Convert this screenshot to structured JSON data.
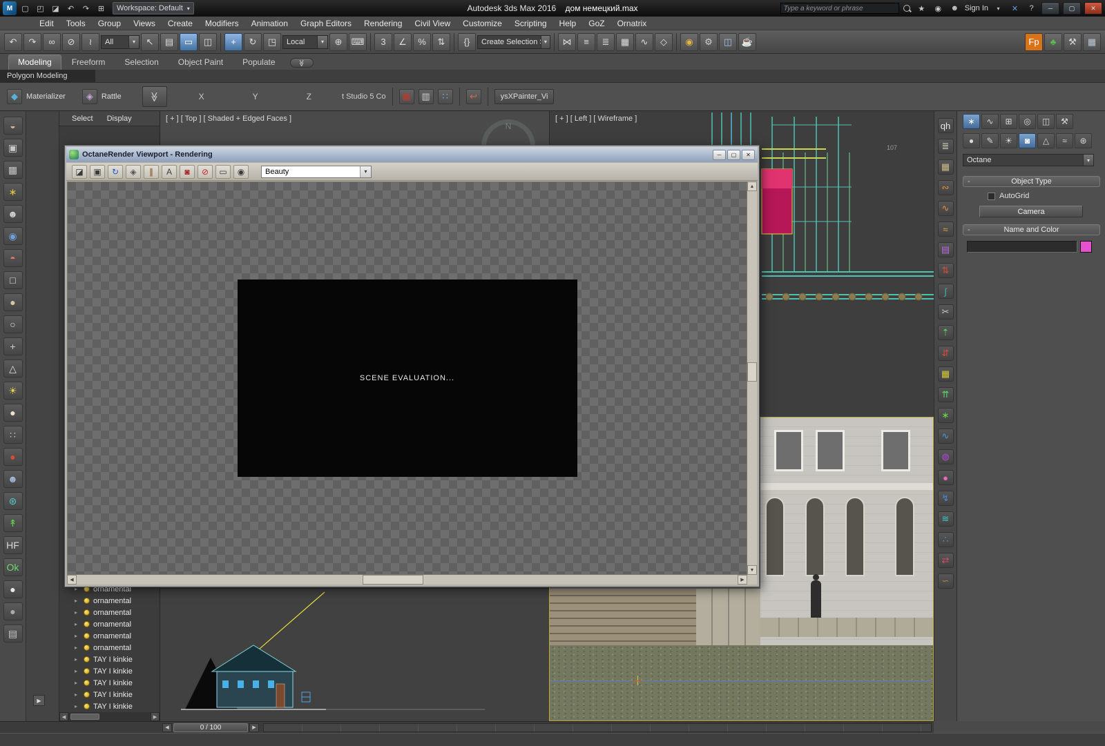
{
  "glyphs": {
    "expand": "▸",
    "dd": "▾",
    "chev2": "≫",
    "min": "─",
    "max": "▢",
    "close": "✕",
    "help": "?",
    "left": "◀",
    "right": "▶",
    "up": "▲",
    "down": "▼"
  },
  "titlebar": {
    "logo_text": "M",
    "quick_icons": [
      {
        "n": "new-scene-icon",
        "g": "▢"
      },
      {
        "n": "open-file-icon",
        "g": "◰"
      },
      {
        "n": "save-file-icon",
        "g": "◪"
      },
      {
        "n": "undo-small-icon",
        "g": "↶"
      },
      {
        "n": "redo-small-icon",
        "g": "↷"
      },
      {
        "n": "project-folder-icon",
        "g": "⊞"
      }
    ],
    "workspace": "Workspace: Default",
    "app_title": "Autodesk 3ds Max 2016",
    "doc_title": "дом немецкий.max",
    "search_placeholder": "Type a keyword or phrase",
    "infocenter_icons": [
      {
        "n": "favorites-star-icon",
        "g": "★"
      },
      {
        "n": "communication-center-icon",
        "g": "◉"
      },
      {
        "n": "user-icon",
        "g": "☻"
      }
    ],
    "sign_in": "Sign In",
    "app_x_icon": "✕"
  },
  "menu": {
    "items": [
      "Edit",
      "Tools",
      "Group",
      "Views",
      "Create",
      "Modifiers",
      "Animation",
      "Graph Editors",
      "Rendering",
      "Civil View",
      "Customize",
      "Scripting",
      "Help",
      "GoZ",
      "Ornatrix"
    ]
  },
  "toolbar_main": {
    "filter_value": "All",
    "coord_value": "Local",
    "selection_set_value": "Create Selection Se",
    "icons_a": [
      {
        "n": "undo-icon",
        "g": "↶"
      },
      {
        "n": "redo-icon",
        "g": "↷"
      },
      {
        "n": "select-and-link-icon",
        "g": "∞"
      },
      {
        "n": "unlink-selection-icon",
        "g": "⊘"
      },
      {
        "n": "bind-to-space-warp-icon",
        "g": "≀"
      }
    ],
    "icons_b": [
      {
        "n": "select-object-icon",
        "g": "↖"
      },
      {
        "n": "select-by-name-icon",
        "g": "▤"
      },
      {
        "n": "selection-region-icon",
        "g": "▭",
        "hl": true
      },
      {
        "n": "window-crossing-icon",
        "g": "◫"
      }
    ],
    "icons_c": [
      {
        "n": "select-and-move-icon",
        "g": "+",
        "hl": true
      },
      {
        "n": "select-and-rotate-icon",
        "g": "↻"
      },
      {
        "n": "select-and-scale-icon",
        "g": "◳"
      }
    ],
    "icons_d": [
      {
        "n": "select-and-manipulate-icon",
        "g": "⊕"
      },
      {
        "n": "keyboard-override-icon",
        "g": "⌨"
      }
    ],
    "icons_e": [
      {
        "n": "snaps-toggle-icon",
        "g": "3"
      },
      {
        "n": "angle-snap-icon",
        "g": "∠"
      },
      {
        "n": "percent-snap-icon",
        "g": "%"
      },
      {
        "n": "spinner-snap-icon",
        "g": "⇅"
      }
    ],
    "icons_f": [
      {
        "n": "named-selection-sets-icon",
        "g": "{}"
      }
    ],
    "icons_g": [
      {
        "n": "mirror-icon",
        "g": "⋈"
      },
      {
        "n": "align-icon",
        "g": "≡"
      },
      {
        "n": "layer-manager-icon",
        "g": "≣"
      },
      {
        "n": "ribbon-toggle-icon",
        "g": "▦"
      },
      {
        "n": "curve-editor-icon",
        "g": "∿"
      },
      {
        "n": "schematic-view-icon",
        "g": "◇"
      }
    ],
    "icons_h": [
      {
        "n": "material-editor-icon",
        "g": "◉",
        "c": "#e3b341"
      },
      {
        "n": "render-setup-icon",
        "g": "⚙",
        "c": "#cfcfcf"
      },
      {
        "n": "rendered-frame-window-icon",
        "g": "◫",
        "c": "#9fc3e8"
      },
      {
        "n": "render-production-icon",
        "g": "☕",
        "c": "#e0a060"
      }
    ],
    "icons_i": [
      {
        "n": "fp-plugin-button",
        "g": "Fp",
        "bg": "#d8731a",
        "c": "#fff"
      },
      {
        "n": "forest-plugin-icon",
        "g": "♣",
        "c": "#55c14f"
      },
      {
        "n": "tools-plugin-icon",
        "g": "⚒",
        "c": "#d8d8d8"
      },
      {
        "n": "grid-plugin-icon",
        "g": "▦",
        "c": "#bac9d8"
      }
    ]
  },
  "ribbon": {
    "tabs": [
      {
        "label": "Modeling",
        "active": true
      },
      {
        "label": "Freeform"
      },
      {
        "label": "Selection"
      },
      {
        "label": "Object Paint"
      },
      {
        "label": "Populate"
      }
    ],
    "subtab": "Polygon Modeling"
  },
  "toolbar2": {
    "materializer": "Materializer",
    "rattle": "Rattle",
    "x": "X",
    "y": "Y",
    "z": "Z",
    "studio": "t Studio 5 Co",
    "painter": "ysXPainter_Vi",
    "icons": [
      {
        "n": "fence-grid-icon",
        "g": "▦",
        "c": "#c0392b"
      },
      {
        "n": "ruler-icon",
        "g": "▥",
        "c": "#cfcfcf"
      },
      {
        "n": "dots-grid-icon",
        "g": "∷",
        "c": "#7fb3e8"
      }
    ],
    "curve_arrow_icon": "↩"
  },
  "left_toolbar": {
    "icons": [
      {
        "n": "teapot-icon",
        "g": "◒",
        "c": "#c9b79a"
      },
      {
        "n": "image-plane-icon",
        "g": "▣",
        "c": "#c8c8c8"
      },
      {
        "n": "grid-array-icon",
        "g": "▦",
        "c": "#c8c8c8"
      },
      {
        "n": "spark-icon",
        "g": "∗",
        "c": "#e6c63c"
      },
      {
        "n": "figure-icon",
        "g": "☻",
        "c": "#cfcfcf"
      },
      {
        "n": "orb-blue-icon",
        "g": "◉",
        "c": "#6f9fd8"
      },
      {
        "n": "ball-duo-icon",
        "g": "◓",
        "c": "#d87a66"
      },
      {
        "n": "box-icon",
        "g": "□",
        "c": "#e0e0e0"
      },
      {
        "n": "sphere-tan-icon",
        "g": "●",
        "c": "#d8c8a4"
      },
      {
        "n": "circle-icon",
        "g": "○",
        "c": "#e0e0e0"
      },
      {
        "n": "cross-tool-icon",
        "g": "+",
        "c": "#d0d0d0"
      },
      {
        "n": "cone-icon",
        "g": "△",
        "c": "#e0e0e0"
      },
      {
        "n": "sun-icon",
        "g": "☀",
        "c": "#e8d34a"
      },
      {
        "n": "sphere-cream-icon",
        "g": "●",
        "c": "#ece4cc"
      },
      {
        "n": "dots-icon",
        "g": "∷",
        "c": "#c8c8c8"
      },
      {
        "n": "sphere-red-icon",
        "g": "●",
        "c": "#d84a38"
      },
      {
        "n": "figure-blue-icon",
        "g": "☻",
        "c": "#9fb8d8"
      },
      {
        "n": "gear-teal-icon",
        "g": "⊛",
        "c": "#59c9c9"
      },
      {
        "n": "plant-icon",
        "g": "↟",
        "c": "#63d44f"
      },
      {
        "n": "hf-icon",
        "g": "HF",
        "c": "#d8d8d8"
      },
      {
        "n": "ok-icon",
        "g": "Ok",
        "c": "#6fd86f"
      },
      {
        "n": "sphere-white-icon",
        "g": "●",
        "c": "#e8e8e8"
      },
      {
        "n": "sphere-gray-icon",
        "g": "●",
        "c": "#aaaaaa"
      },
      {
        "n": "panel-icon",
        "g": "▤",
        "c": "#c8c8c8"
      }
    ]
  },
  "explorer": {
    "menus": [
      "Select",
      "Display"
    ],
    "rows": [
      {
        "l": "ornamental"
      },
      {
        "l": "ornamental"
      },
      {
        "l": "ornamental"
      },
      {
        "l": "ornamental"
      },
      {
        "l": "ornamental"
      },
      {
        "l": "ornamental"
      },
      {
        "l": "TAY I kinkie"
      },
      {
        "l": "TAY I kinkie"
      },
      {
        "l": "TAY I kinkie"
      },
      {
        "l": "TAY I kinkie"
      },
      {
        "l": "TAY I kinkie"
      }
    ]
  },
  "viewports": {
    "top_label": "[ + ] [ Top ] [ Shaded + Edged Faces ]",
    "left_label": "[ + ] [ Left ] [ Wireframe ]",
    "compass": "N",
    "cad_note": "107"
  },
  "render_window": {
    "title": "OctaneRender Viewport - Rendering",
    "pass_value": "Beauty",
    "status_text": "SCENE EVALUATION...",
    "toolbar_icons": [
      {
        "n": "save-image-icon",
        "g": "◪",
        "c": "#3a3a3a"
      },
      {
        "n": "copy-image-icon",
        "g": "▣",
        "c": "#3a3a3a"
      },
      {
        "n": "refresh-render-icon",
        "g": "↻",
        "c": "#2255cc"
      },
      {
        "n": "lock-view-icon",
        "g": "◈",
        "c": "#555555"
      },
      {
        "n": "pause-render-icon",
        "g": "∥",
        "c": "#7a4a10"
      },
      {
        "n": "stamp-text-icon",
        "g": "A",
        "c": "#3a3a3a"
      },
      {
        "n": "render-region-icon",
        "g": "◙",
        "c": "#aa2222"
      },
      {
        "n": "stop-render-icon",
        "g": "⊘",
        "c": "#cc2222"
      },
      {
        "n": "display-mode-icon",
        "g": "▭",
        "c": "#3a3a3a"
      },
      {
        "n": "camera-lock-icon",
        "g": "◉",
        "c": "#3a3a3a"
      }
    ]
  },
  "ornatrix": {
    "icons": [
      {
        "n": "ornatrix-qh-icon",
        "g": "qh",
        "c": "#e8e8e8"
      },
      {
        "n": "ornatrix-guides-icon",
        "g": "≣",
        "c": "#dcd6c8"
      },
      {
        "n": "ornatrix-box-icon",
        "g": "▦",
        "c": "#cbb98a"
      },
      {
        "n": "ornatrix-curl-icon",
        "g": "∾",
        "c": "#e8923a"
      },
      {
        "n": "ornatrix-strand-icon",
        "g": "∿",
        "c": "#e8923a"
      },
      {
        "n": "ornatrix-waves-icon",
        "g": "≈",
        "c": "#e8a23a"
      },
      {
        "n": "ornatrix-stack-icon",
        "g": "▤",
        "c": "#b86ad8"
      },
      {
        "n": "ornatrix-updown-icon",
        "g": "⇅",
        "c": "#d84a3a"
      },
      {
        "n": "ornatrix-flow-icon",
        "g": "∫",
        "c": "#3ab8a8"
      },
      {
        "n": "ornatrix-scissors-icon",
        "g": "✂",
        "c": "#c8c8c8"
      },
      {
        "n": "ornatrix-sprout-icon",
        "g": "⇡",
        "c": "#5ad85a"
      },
      {
        "n": "ornatrix-redgreen-icon",
        "g": "⇵",
        "c": "#d84a3a"
      },
      {
        "n": "ornatrix-grid-icon",
        "g": "▦",
        "c": "#d8c83a"
      },
      {
        "n": "ornatrix-arrows-icon",
        "g": "⇈",
        "c": "#5ad86a"
      },
      {
        "n": "ornatrix-leaf-icon",
        "g": "∗",
        "c": "#6ad84a"
      },
      {
        "n": "ornatrix-blue-s-icon",
        "g": "∿",
        "c": "#4a9ad8"
      },
      {
        "n": "ornatrix-purple-icon",
        "g": "◍",
        "c": "#b04ad8"
      },
      {
        "n": "ornatrix-pink-ball-icon",
        "g": "●",
        "c": "#e86ab8"
      },
      {
        "n": "ornatrix-blue-curl-icon",
        "g": "↯",
        "c": "#4a8ad8"
      },
      {
        "n": "ornatrix-teal-wave-icon",
        "g": "≋",
        "c": "#3ac8c8"
      },
      {
        "n": "ornatrix-drops-icon",
        "g": "∴",
        "c": "#4a9ad8"
      },
      {
        "n": "ornatrix-redblue-icon",
        "g": "⇄",
        "c": "#d84a6a"
      },
      {
        "n": "ornatrix-brown-curl-icon",
        "g": "∽",
        "c": "#b8834a"
      }
    ]
  },
  "command_panel": {
    "tab_icons_row1": [
      {
        "n": "create-tab-icon",
        "g": "∗",
        "hl": true
      },
      {
        "n": "modify-tab-icon",
        "g": "∿"
      },
      {
        "n": "hierarchy-tab-icon",
        "g": "⊞"
      },
      {
        "n": "motion-tab-icon",
        "g": "◎"
      },
      {
        "n": "display-tab-icon",
        "g": "◫"
      },
      {
        "n": "utilities-tab-icon",
        "g": "⚒"
      }
    ],
    "tab_icons_row2": [
      {
        "n": "geometry-category-icon",
        "g": "●"
      },
      {
        "n": "shapes-category-icon",
        "g": "✎"
      },
      {
        "n": "lights-category-icon",
        "g": "☀"
      },
      {
        "n": "cameras-category-icon",
        "g": "◙",
        "hl": true
      },
      {
        "n": "helpers-category-icon",
        "g": "△"
      },
      {
        "n": "space-warps-category-icon",
        "g": "≈"
      },
      {
        "n": "systems-category-icon",
        "g": "⊛"
      }
    ],
    "category_value": "Octane",
    "rollout_object_type": "Object Type",
    "autogrid_label": "AutoGrid",
    "camera_button": "Camera",
    "rollout_name_color": "Name and Color",
    "swatch_color": "#e750cf"
  },
  "timeline": {
    "frame_label": "0 / 100"
  }
}
